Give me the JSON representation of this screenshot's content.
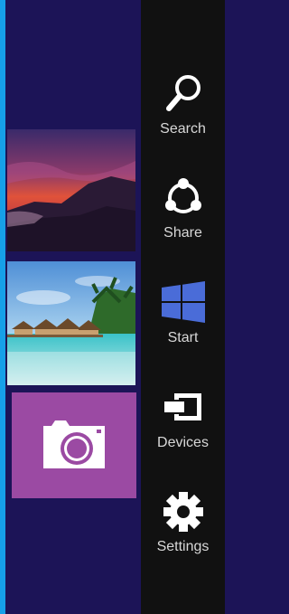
{
  "colors": {
    "accent_edge": "#16a0e8",
    "start_background": "#1c1457",
    "charms_background": "#111111",
    "charm_icon": "#ffffff",
    "charm_label": "#d8d8d8",
    "start_logo": "#4a6cd8",
    "camera_tile": "#9b4aa3"
  },
  "tiles": [
    {
      "name": "photos-sunset",
      "icon": "photo-mountain-sunset"
    },
    {
      "name": "photos-beach",
      "icon": "photo-tropical-beach"
    },
    {
      "name": "camera",
      "icon": "camera-icon"
    }
  ],
  "charms": [
    {
      "label": "Search",
      "icon": "search-icon"
    },
    {
      "label": "Share",
      "icon": "share-icon"
    },
    {
      "label": "Start",
      "icon": "windows-logo-icon"
    },
    {
      "label": "Devices",
      "icon": "devices-icon"
    },
    {
      "label": "Settings",
      "icon": "gear-icon"
    }
  ]
}
